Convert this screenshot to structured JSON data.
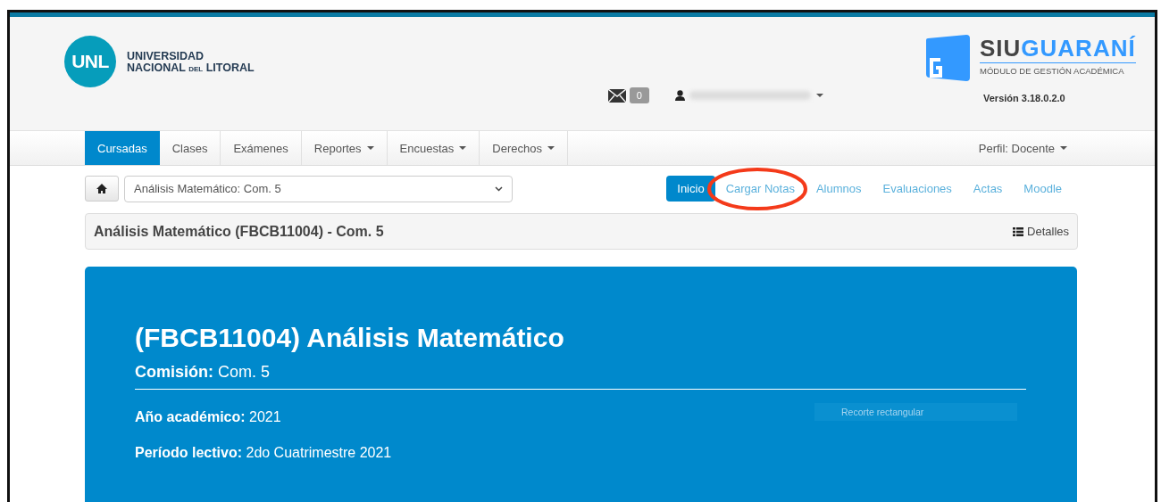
{
  "header": {
    "university_logo": {
      "badge": "UNL",
      "line_1": "UNIVERSIDAD",
      "line_2_start": "NACIONAL",
      "line_2_small": "DEL",
      "line_2_end": "LITORAL"
    },
    "messages": {
      "count": "0"
    },
    "product": {
      "name_dark": "SIU",
      "name_accent": "GUARANÍ",
      "subtitle": "MÓDULO DE GESTIÓN ACADÉMICA",
      "version": "Versión 3.18.0.2.0"
    }
  },
  "nav": {
    "tabs": [
      {
        "label": "Cursadas",
        "selected": true,
        "has_menu": false
      },
      {
        "label": "Clases",
        "selected": false,
        "has_menu": false
      },
      {
        "label": "Exámenes",
        "selected": false,
        "has_menu": false
      },
      {
        "label": "Reportes",
        "selected": false,
        "has_menu": true
      },
      {
        "label": "Encuestas",
        "selected": false,
        "has_menu": true
      },
      {
        "label": "Derechos",
        "selected": false,
        "has_menu": true
      }
    ],
    "profile": "Perfil: Docente"
  },
  "course_selector": {
    "value": "Análisis Matemático: Com. 5"
  },
  "course_nav": [
    {
      "label": "Inicio",
      "selected": true,
      "annotated": false
    },
    {
      "label": "Cargar Notas",
      "selected": false,
      "annotated": true
    },
    {
      "label": "Alumnos",
      "selected": false,
      "annotated": false
    },
    {
      "label": "Evaluaciones",
      "selected": false,
      "annotated": false
    },
    {
      "label": "Actas",
      "selected": false,
      "annotated": false
    },
    {
      "label": "Moodle",
      "selected": false,
      "annotated": false
    }
  ],
  "panel": {
    "title": "Análisis Matemático (FBCB11004) - Com. 5",
    "details_button": "Detalles"
  },
  "hero": {
    "title": "(FBCB11004) Análisis Matemático",
    "fields": [
      {
        "kind": "primary",
        "label": "Comisión:",
        "value": "Com. 5"
      },
      {
        "kind": "detail",
        "label": "Año académico:",
        "value": "2021"
      },
      {
        "kind": "detail",
        "label": "Período lectivo:",
        "value": "2do Cuatrimestre 2021"
      }
    ],
    "overlay_hint": "Recorte rectangular"
  }
}
